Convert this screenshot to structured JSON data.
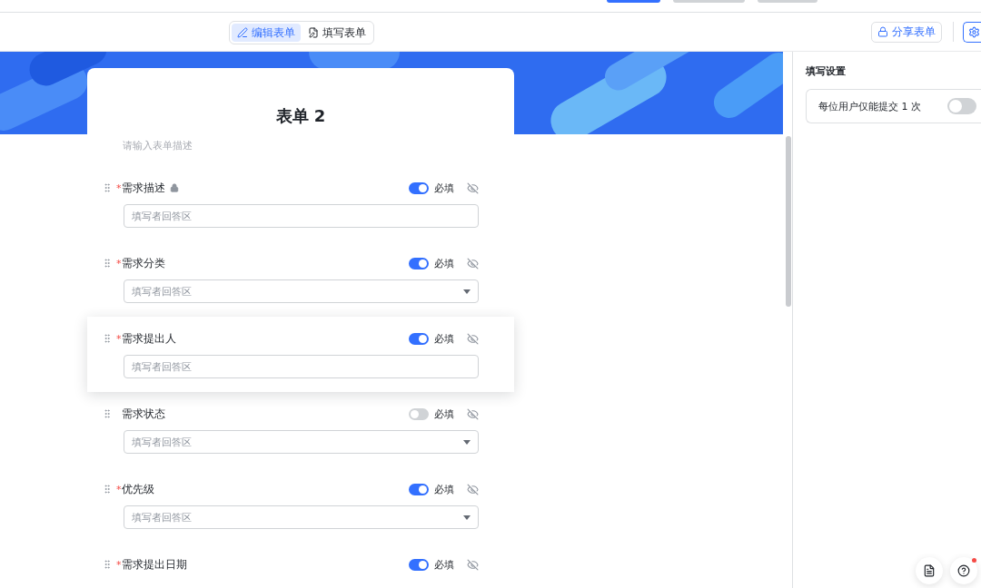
{
  "toolbar": {
    "tabs": [
      {
        "label": "编辑表单",
        "kind": "edit",
        "selected": true
      },
      {
        "label": "填写表单",
        "kind": "fill",
        "selected": false
      }
    ],
    "share_button": "分享表单"
  },
  "form": {
    "title": "表单 2",
    "description_placeholder": "请输入表单描述",
    "fields": [
      {
        "label": "需求描述",
        "kind": "text",
        "required": true,
        "required_mark": "*",
        "locked": true,
        "selected": false,
        "placeholder": "填写者回答区",
        "required_label": "必填"
      },
      {
        "label": "需求分类",
        "kind": "select",
        "required": true,
        "required_mark": "*",
        "locked": false,
        "selected": false,
        "placeholder": "填写者回答区",
        "required_label": "必填"
      },
      {
        "label": "需求提出人",
        "kind": "text",
        "required": true,
        "required_mark": "*",
        "locked": false,
        "selected": true,
        "placeholder": "填写者回答区",
        "required_label": "必填"
      },
      {
        "label": "需求状态",
        "kind": "select",
        "required": false,
        "locked": false,
        "selected": false,
        "placeholder": "填写者回答区",
        "required_label": "必填"
      },
      {
        "label": "优先级",
        "kind": "select",
        "required": true,
        "required_mark": "*",
        "locked": false,
        "selected": false,
        "placeholder": "填写者回答区",
        "required_label": "必填"
      },
      {
        "label": "需求提出日期",
        "kind": "cut",
        "required": true,
        "required_mark": "*",
        "locked": false,
        "selected": false,
        "required_label": "必填"
      }
    ]
  },
  "settings": {
    "title": "填写设置",
    "options": [
      {
        "label": "每位用户仅能提交 1 次",
        "on": false
      }
    ]
  },
  "floating_buttons": [
    {
      "kind": "doc",
      "badge": false
    },
    {
      "kind": "help",
      "badge": true
    }
  ]
}
